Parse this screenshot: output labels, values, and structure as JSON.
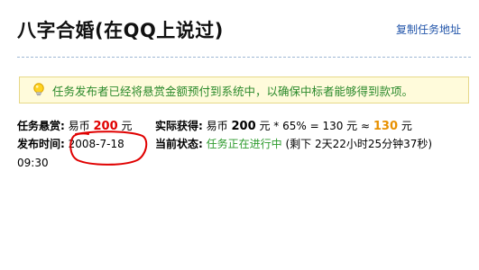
{
  "header": {
    "title": "八字合婚(在QQ上说过)",
    "copy_link": "复制任务地址"
  },
  "notice": {
    "icon": "lightbulb-icon",
    "text": "任务发布者已经将悬赏金额预付到系统中，以确保中标者能够得到款项。"
  },
  "task": {
    "reward_label": "任务悬赏:",
    "reward_currency": "易币",
    "reward_amount": "200",
    "reward_unit": "元",
    "actual_label": "实际获得:",
    "actual_currency": "易币",
    "actual_amount": "200",
    "actual_unit": "元",
    "actual_formula": "* 65% = 130 元 ≈",
    "actual_result": "130",
    "actual_result_unit": "元",
    "publish_label": "发布时间:",
    "publish_date": "2008-7-18",
    "publish_time": "09:30",
    "status_label": "当前状态:",
    "status_text": "任务正在进行中",
    "remaining_text": "(剩下 2天22小时25分钟37秒)"
  },
  "colors": {
    "accent_red": "#e00000",
    "accent_orange": "#e89000",
    "status_green": "#2c9a2c",
    "link_blue": "#2255aa",
    "notice_bg": "#fffbdb"
  }
}
